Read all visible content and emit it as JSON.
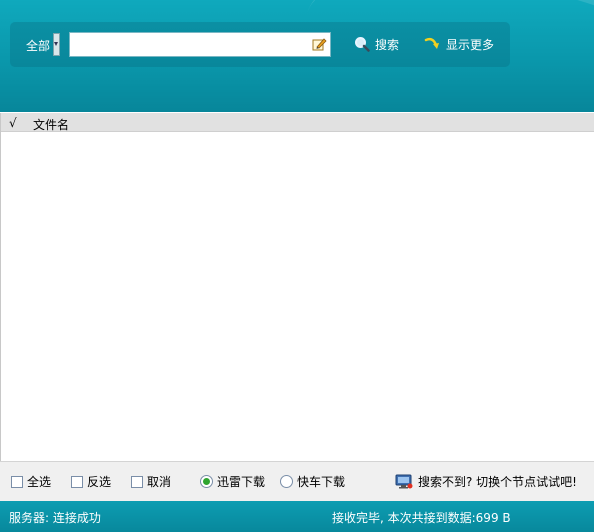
{
  "search": {
    "scope_label": "全部",
    "query_value": "",
    "search_button": "搜索",
    "more_button": "显示更多"
  },
  "file_list": {
    "columns": [
      "√",
      "文件名"
    ],
    "rows": []
  },
  "options": {
    "select_all": "全选",
    "invert_selection": "反选",
    "cancel": "取消",
    "download_modes": [
      {
        "label": "迅雷下载",
        "selected": true
      },
      {
        "label": "快车下载",
        "selected": false
      }
    ],
    "hint_link": "搜索不到? 切换个节点试试吧!"
  },
  "status": {
    "server": "服务器: 连接成功",
    "result": "接收完毕, 本次共接到数据:699 B"
  },
  "colors": {
    "header_teal": "#0a97ab",
    "status_teal": "#08889c",
    "radio_selected": "#2fa52f"
  },
  "icons": [
    "edit-icon",
    "magnifier-icon",
    "arrow-more-icon",
    "monitor-icon"
  ]
}
